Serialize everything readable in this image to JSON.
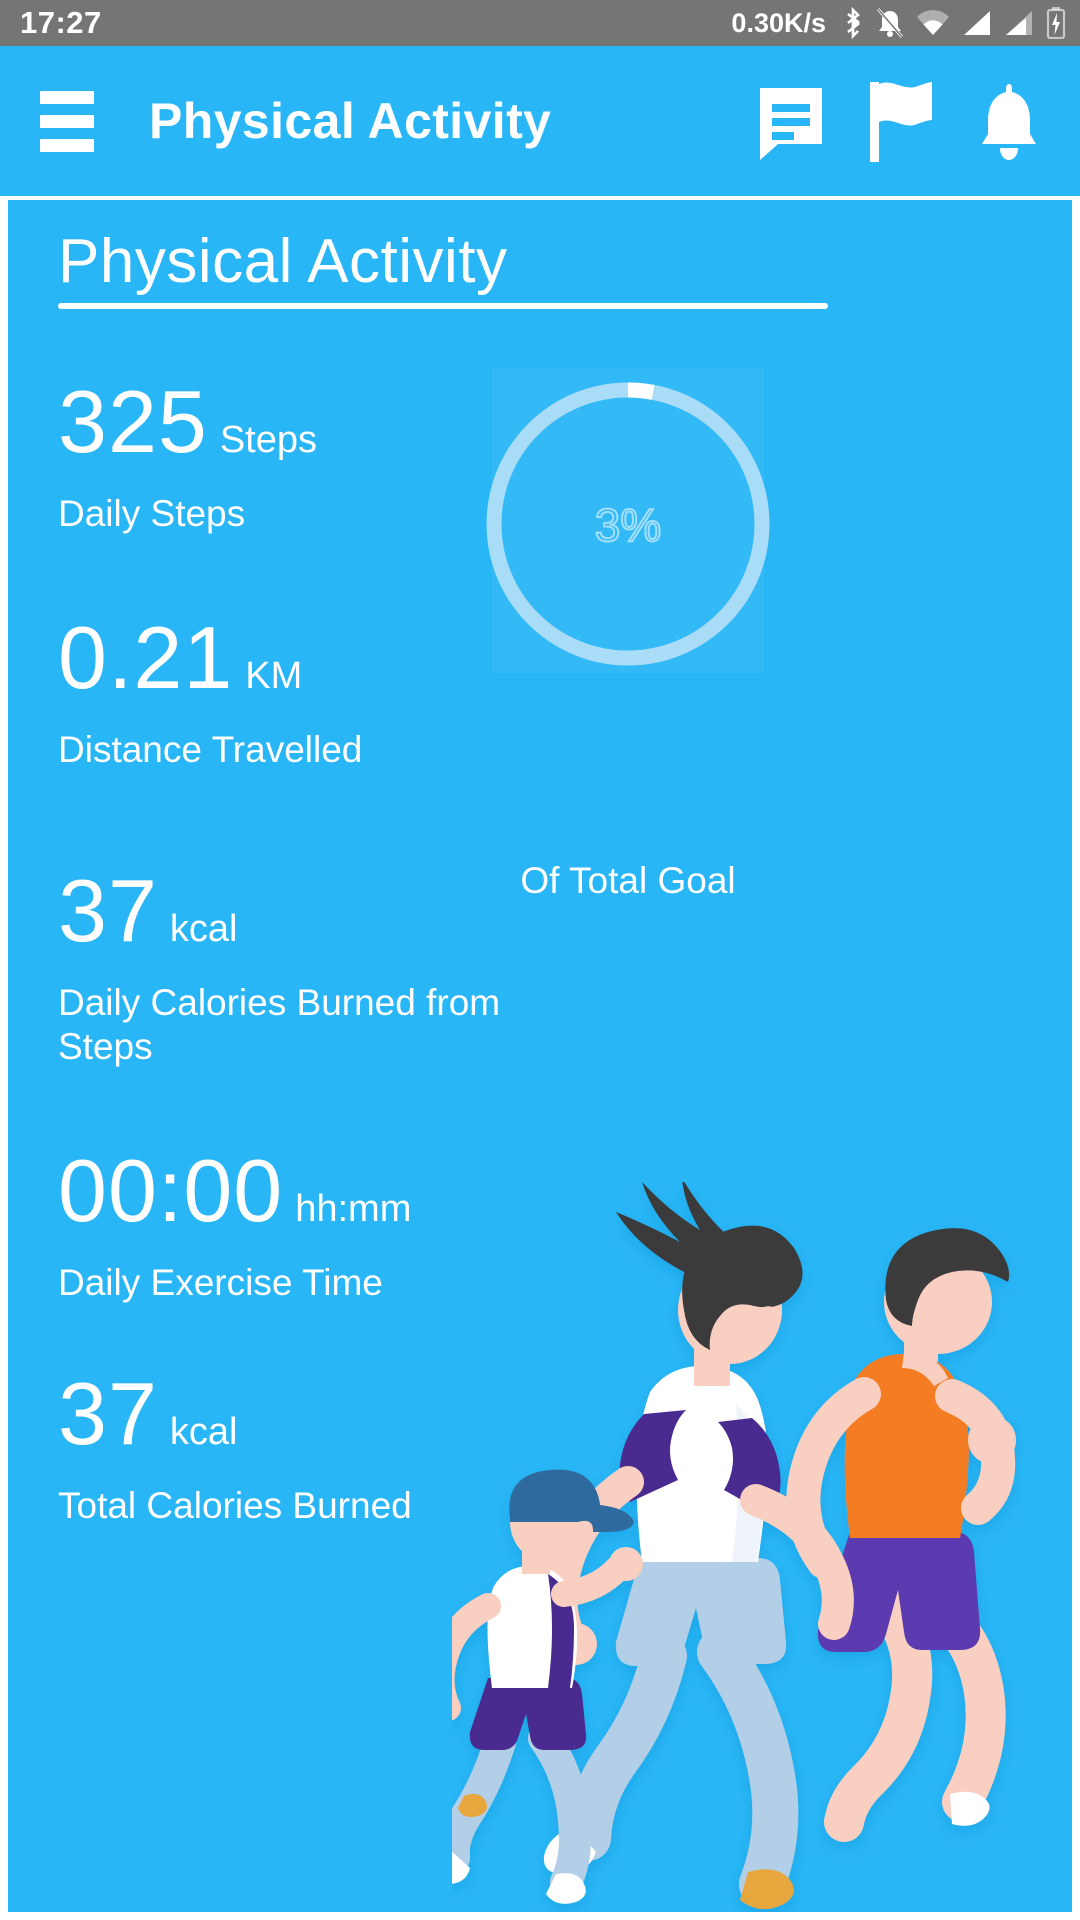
{
  "status_bar": {
    "time": "17:27",
    "network_speed": "0.30K/s",
    "icons": [
      "bluetooth-icon",
      "silent-bell-icon",
      "wifi-icon",
      "signal-icon",
      "signal-icon",
      "battery-charging-icon"
    ]
  },
  "app_bar": {
    "menu_icon": "hamburger-menu-icon",
    "title": "Physical Activity",
    "actions": [
      {
        "icon": "chat-message-icon",
        "name": "messages-button"
      },
      {
        "icon": "flag-icon",
        "name": "flag-button"
      },
      {
        "icon": "bell-icon",
        "name": "notifications-button"
      }
    ]
  },
  "page": {
    "heading": "Physical Activity"
  },
  "stats": [
    {
      "value": "325",
      "unit": "Steps",
      "label": "Daily Steps"
    },
    {
      "value": "0.21",
      "unit": "KM",
      "label": "Distance Travelled"
    },
    {
      "value": "37",
      "unit": "kcal",
      "label": "Daily Calories Burned from Steps"
    },
    {
      "value": "00:00",
      "unit": "hh:mm",
      "label": "Daily Exercise Time"
    },
    {
      "value": "37",
      "unit": "kcal",
      "label": "Total Calories Burned"
    }
  ],
  "goal_ring": {
    "percent_text": "3%",
    "percent_value": 3,
    "caption": "Of Total Goal"
  },
  "illustration": {
    "name": "running-family-illustration",
    "alt": "Three people running: woman, man and child"
  },
  "colors": {
    "brand_blue": "#29b6f6",
    "status_bar_gray": "#757575",
    "ring_track": "#a8dcf7",
    "ring_progress": "#ffffff",
    "skin": "#f8cfc0",
    "hair_dark": "#3b3a3a",
    "shirt_white": "#ffffff",
    "purple_dark": "#4a2a8f",
    "purple_mid": "#5b3bb0",
    "orange": "#f47b20",
    "jeans_light": "#b3cfe8",
    "cap_blue": "#2d6b9e",
    "shoe_yellow": "#e8a73c"
  }
}
